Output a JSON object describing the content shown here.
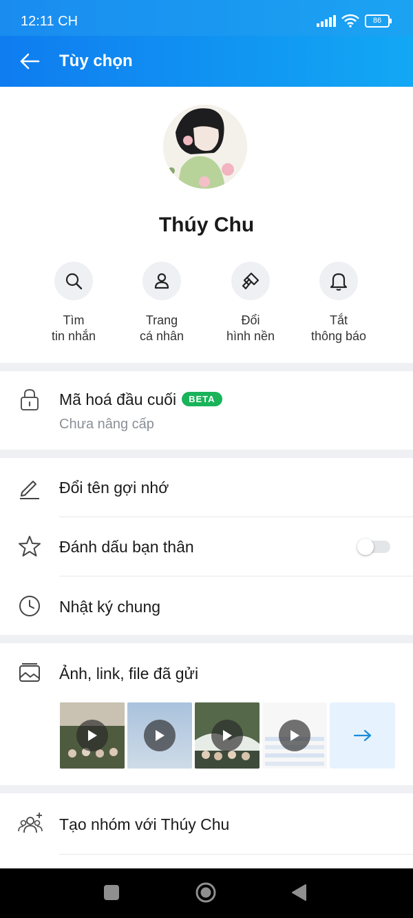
{
  "status_bar": {
    "time": "12:11 CH",
    "battery": "86"
  },
  "header": {
    "title": "Tùy chọn"
  },
  "profile": {
    "name": "Thúy Chu"
  },
  "actions": [
    {
      "label": "Tìm\ntin nhắn",
      "icon": "search-icon"
    },
    {
      "label": "Trang\ncá nhân",
      "icon": "person-icon"
    },
    {
      "label": "Đổi\nhình nền",
      "icon": "paintbrush-icon"
    },
    {
      "label": "Tắt\nthông báo",
      "icon": "bell-icon"
    }
  ],
  "encryption": {
    "title": "Mã hoá đầu cuối",
    "badge": "BETA",
    "subtitle": "Chưa nâng cấp"
  },
  "menu": {
    "rename": "Đổi tên gợi nhớ",
    "best_friend": "Đánh dấu bạn thân",
    "best_friend_enabled": false,
    "diary": "Nhật ký chung"
  },
  "media": {
    "title": "Ảnh, link, file đã gửi",
    "thumbnails": [
      {
        "type": "video"
      },
      {
        "type": "video"
      },
      {
        "type": "video"
      },
      {
        "type": "video"
      }
    ]
  },
  "create_group": {
    "label": "Tạo nhóm với Thúy Chu"
  },
  "colors": {
    "accent": "#0f7cf0",
    "beta": "#19b35a",
    "separator": "#eef0f3"
  }
}
